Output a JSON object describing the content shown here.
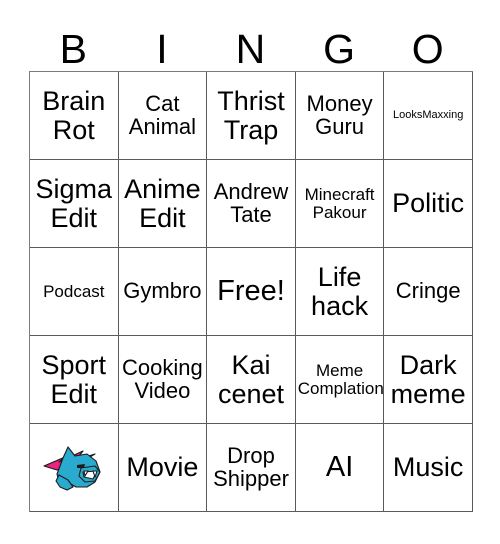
{
  "page": {
    "title": "BINGO Card",
    "background_color": "#ffffff",
    "border_color": "#5a5a5a"
  },
  "header": {
    "letters": [
      "B",
      "I",
      "N",
      "G",
      "O"
    ]
  },
  "grid": {
    "rows": 5,
    "columns": 5,
    "cells": [
      [
        {
          "label": "Brain Rot",
          "size": "lg",
          "type": "text"
        },
        {
          "label": "Cat Animal",
          "size": "md",
          "type": "text"
        },
        {
          "label": "Thrist Trap",
          "size": "lg",
          "type": "text"
        },
        {
          "label": "Money Guru",
          "size": "md",
          "type": "text"
        },
        {
          "label": "LooksMaxxing",
          "size": "xs",
          "type": "text"
        }
      ],
      [
        {
          "label": "Sigma Edit",
          "size": "lg",
          "type": "text"
        },
        {
          "label": "Anime Edit",
          "size": "lg",
          "type": "text"
        },
        {
          "label": "Andrew Tate",
          "size": "md",
          "type": "text"
        },
        {
          "label": "Minecraft Pakour",
          "size": "sm",
          "type": "text"
        },
        {
          "label": "Politic",
          "size": "lg",
          "type": "text"
        }
      ],
      [
        {
          "label": "Podcast",
          "size": "sm",
          "type": "text"
        },
        {
          "label": "Gymbro",
          "size": "md",
          "type": "text"
        },
        {
          "label": "Free!",
          "size": "xl",
          "type": "text"
        },
        {
          "label": "Life hack",
          "size": "lg",
          "type": "text"
        },
        {
          "label": "Cringe",
          "size": "md",
          "type": "text"
        }
      ],
      [
        {
          "label": "Sport Edit",
          "size": "lg",
          "type": "text"
        },
        {
          "label": "Cooking Video",
          "size": "md",
          "type": "text"
        },
        {
          "label": "Kai cenet",
          "size": "lg",
          "type": "text"
        },
        {
          "label": "Meme Complation",
          "size": "sm",
          "type": "text"
        },
        {
          "label": "Dark meme",
          "size": "lg",
          "type": "text"
        }
      ],
      [
        {
          "label": "",
          "size": "md",
          "type": "logo",
          "icon": "panther-mascot-icon"
        },
        {
          "label": "Movie",
          "size": "lg",
          "type": "text"
        },
        {
          "label": "Drop Shipper",
          "size": "md",
          "type": "text"
        },
        {
          "label": "AI",
          "size": "xl",
          "type": "text"
        },
        {
          "label": "Music",
          "size": "lg",
          "type": "text"
        }
      ]
    ]
  },
  "logo": {
    "name": "panther-mascot-icon",
    "body_color": "#29abcf",
    "bolt_color": "#e8257f",
    "outline_color": "#1b1b1b",
    "mouth_color": "#ffffff"
  }
}
